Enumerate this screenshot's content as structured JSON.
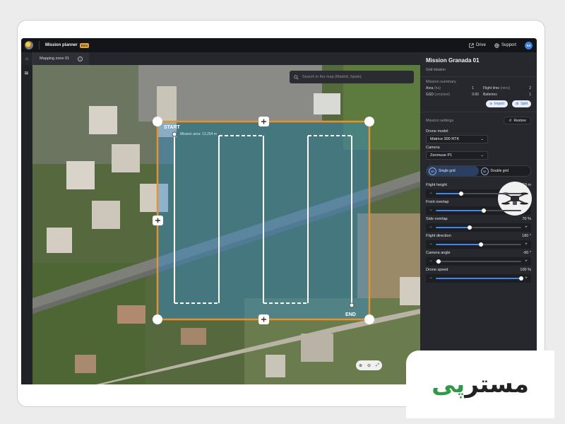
{
  "topbar": {
    "title": "Mission planner",
    "badge": "Beta",
    "drive_label": "Drive",
    "support_label": "Support",
    "avatar_initials": "SA"
  },
  "tabs": [
    {
      "label": "Mapping zone 01"
    }
  ],
  "map": {
    "search_placeholder": "Search in the map (Madrid, Spain)",
    "start_label": "START",
    "end_label": "END",
    "area_label": "Mission area: 13,254 m"
  },
  "panel": {
    "mission_title": "Mission Granada 01",
    "mission_type": "Grid mission",
    "summary_label": "Mission summary",
    "summary": {
      "area_label": "Area",
      "area_unit": "(ha)",
      "area_value": "1",
      "flight_time_label": "Flight time",
      "flight_time_unit": "(mins)",
      "flight_time_value": "2",
      "gsd_label": "GSD",
      "gsd_unit": "(cm/pixel)",
      "gsd_value": "0.60",
      "batteries_label": "Batteries",
      "batteries_value": "1"
    },
    "import_label": "Import",
    "split_label": "Split",
    "settings_label": "Mission settings",
    "restore_label": "Restore",
    "drone_model_label": "Drone model",
    "drone_model_value": "Matrice 300 RTK",
    "camera_label": "Camera",
    "camera_value": "Zenmuse P1",
    "modes": [
      {
        "badge": "2D",
        "label": "Single grid"
      },
      {
        "badge": "3D",
        "label": "Double grid"
      }
    ],
    "sliders": [
      {
        "label": "Flight height",
        "value_text": "50 m",
        "fraction": 0.3
      },
      {
        "label": "Front overlap",
        "value_text": "80 %",
        "fraction": 0.56
      },
      {
        "label": "Side overlap",
        "value_text": "70 %",
        "fraction": 0.4
      },
      {
        "label": "Flight direction",
        "value_text": "180 °",
        "fraction": 0.53
      },
      {
        "label": "Camera angle",
        "value_text": "-90 °",
        "fraction": 0.03
      },
      {
        "label": "Drone speed",
        "value_text": "100 %",
        "fraction": 1.0
      }
    ]
  },
  "brand": {
    "word_main": "مستر",
    "word_accent": "پی"
  },
  "colors": {
    "accent": "#3f86f0",
    "boundary": "#e8922f",
    "overlay": "#2f8fd6"
  }
}
